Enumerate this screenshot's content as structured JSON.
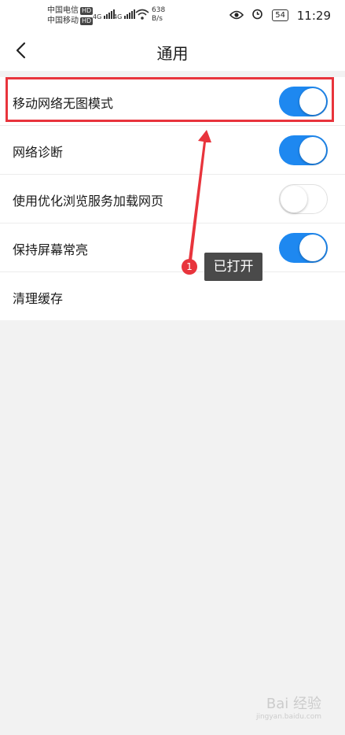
{
  "status_bar": {
    "carrier1": "中国电信",
    "carrier2": "中国移动",
    "hd": "HD",
    "network1": "4G",
    "network2": "4G",
    "speed_value": "638",
    "speed_unit": "B/s",
    "battery": "54",
    "time": "11:29"
  },
  "header": {
    "title": "通用"
  },
  "settings": [
    {
      "label": "移动网络无图模式",
      "toggle": "on"
    },
    {
      "label": "网络诊断",
      "toggle": "on"
    },
    {
      "label": "使用优化浏览服务加载网页",
      "toggle": "off"
    },
    {
      "label": "保持屏幕常亮",
      "toggle": "on"
    },
    {
      "label": "清理缓存",
      "toggle": null
    }
  ],
  "annotation": {
    "step": "1",
    "note": "已打开",
    "highlight_color": "#e8343c"
  },
  "colors": {
    "accent": "#1e88f0",
    "background": "#f2f2f2"
  },
  "watermark": {
    "main": "Bai 经验",
    "sub": "jingyan.baidu.com"
  }
}
